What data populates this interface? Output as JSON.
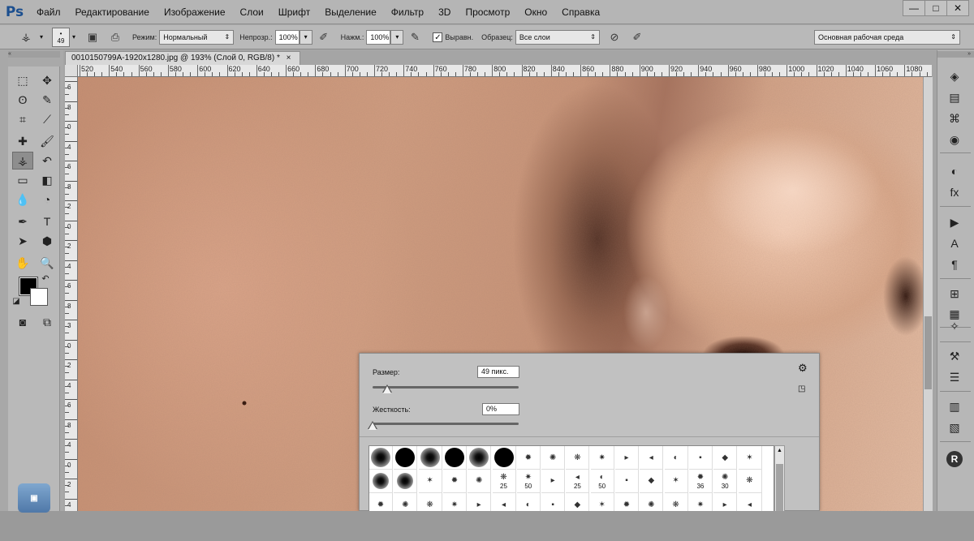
{
  "app": {
    "logo": "Ps",
    "menu": [
      "Файл",
      "Редактирование",
      "Изображение",
      "Слои",
      "Шрифт",
      "Выделение",
      "Фильтр",
      "3D",
      "Просмотр",
      "Окно",
      "Справка"
    ],
    "window_controls": [
      "—",
      "□",
      "✕"
    ]
  },
  "options_bar": {
    "brush_size": "49",
    "mode_label": "Режим:",
    "mode_value": "Нормальный",
    "opacity_label": "Непрозр.:",
    "opacity_value": "100%",
    "flow_label": "Нажм.:",
    "flow_value": "100%",
    "aligned_label": "Выравн.",
    "aligned_checked": true,
    "sample_label": "Образец:",
    "sample_value": "Все слои",
    "workspace": "Основная рабочая среда"
  },
  "document": {
    "tab_title": "0010150799A-1920x1280.jpg @ 193% (Слой 0, RGB/8) *",
    "ruler_top_labels": [
      "520",
      "540",
      "560",
      "580",
      "600",
      "620",
      "640",
      "660",
      "680",
      "700",
      "720",
      "740",
      "760",
      "780",
      "800",
      "820",
      "840",
      "860",
      "880",
      "900",
      "920",
      "940",
      "960",
      "980",
      "1000",
      "1020",
      "1040",
      "1060",
      "1080"
    ],
    "ruler_left_labels": [
      "6",
      "8",
      "0",
      "4",
      "6",
      "8",
      "2",
      "0",
      "2",
      "4",
      "6",
      "8",
      "3",
      "0",
      "2",
      "4",
      "6",
      "8",
      "4",
      "0",
      "2",
      "4"
    ]
  },
  "brush_picker": {
    "size_label": "Размер:",
    "size_value": "49 пикс.",
    "size_fraction": 0.1,
    "hardness_label": "Жесткость:",
    "hardness_value": "0%",
    "hardness_fraction": 0.0,
    "row1": [
      "soft",
      "hard",
      "soft",
      "hard",
      "soft",
      "hard",
      "g",
      "g",
      "g",
      "g",
      "g",
      "g",
      "g",
      "g",
      "g",
      "g"
    ],
    "row2_numbers": [
      "",
      "",
      "",
      "",
      "",
      "25",
      "50",
      "",
      "25",
      "50",
      "",
      "",
      "",
      "36",
      "30",
      ""
    ],
    "row3_numbers": [
      "",
      "",
      "",
      "",
      "",
      "",
      "",
      "",
      "",
      "",
      "",
      "",
      "",
      "",
      "",
      ""
    ]
  }
}
